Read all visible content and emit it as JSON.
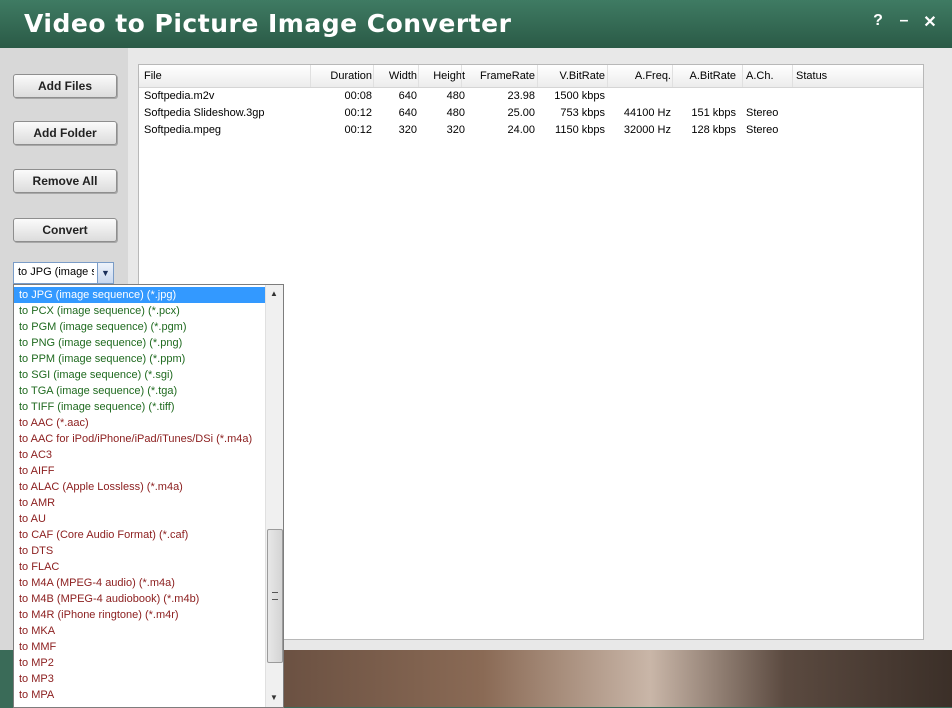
{
  "window": {
    "title": "Video to Picture Image Converter",
    "help_label": "?",
    "minimize_label": "–",
    "close_label": "✕"
  },
  "sidebar": {
    "buttons": {
      "add_files": "Add Files",
      "add_folder": "Add Folder",
      "remove_all": "Remove All",
      "convert": "Convert"
    },
    "format_combo": {
      "value": "to JPG (image s"
    }
  },
  "table": {
    "headers": [
      "File",
      "Duration",
      "Width",
      "Height",
      "FrameRate",
      "V.BitRate",
      "A.Freq.",
      "A.BitRate",
      "A.Ch.",
      "Status"
    ],
    "rows": [
      [
        "Softpedia.m2v",
        "00:08",
        "640",
        "480",
        "23.98",
        "1500 kbps",
        "",
        "",
        "",
        ""
      ],
      [
        "Softpedia Slideshow.3gp",
        "00:12",
        "640",
        "480",
        "25.00",
        "753 kbps",
        "44100 Hz",
        "151 kbps",
        "Stereo",
        ""
      ],
      [
        "Softpedia.mpeg",
        "00:12",
        "320",
        "320",
        "24.00",
        "1150 kbps",
        "32000 Hz",
        "128 kbps",
        "Stereo",
        ""
      ]
    ]
  },
  "dropdown": {
    "items": [
      "to JPG (image sequence) (*.jpg)",
      "to PCX (image sequence) (*.pcx)",
      "to PGM (image sequence) (*.pgm)",
      "to PNG (image sequence) (*.png)",
      "to PPM (image sequence) (*.ppm)",
      "to SGI (image sequence) (*.sgi)",
      "to TGA (image sequence) (*.tga)",
      "to TIFF (image sequence) (*.tiff)",
      "to AAC (*.aac)",
      "to AAC for iPod/iPhone/iPad/iTunes/DSi (*.m4a)",
      "to AC3",
      "to AIFF",
      "to ALAC (Apple Lossless) (*.m4a)",
      "to AMR",
      "to AU",
      "to CAF (Core Audio Format) (*.caf)",
      "to DTS",
      "to FLAC",
      "to M4A (MPEG-4 audio) (*.m4a)",
      "to M4B (MPEG-4 audiobook) (*.m4b)",
      "to M4R (iPhone ringtone) (*.m4r)",
      "to MKA",
      "to MMF",
      "to MP2",
      "to MP3",
      "to MPA"
    ],
    "selected_index": 0,
    "image_group_count": 8
  },
  "colors": {
    "title_bar": "#2f6a52",
    "image_format_text": "#1f6a1f",
    "audio_format_text": "#8b1d1d",
    "selection": "#3399ff"
  }
}
